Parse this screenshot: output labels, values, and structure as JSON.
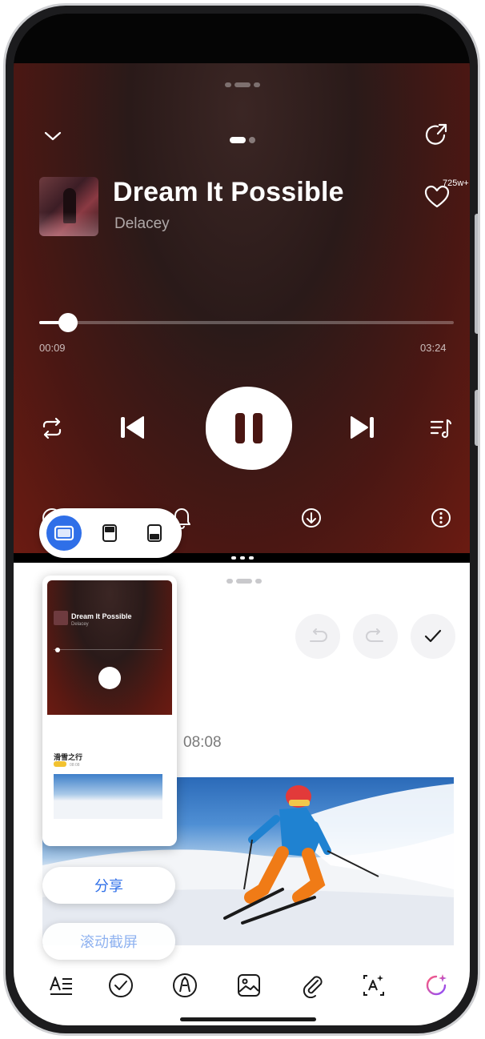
{
  "player": {
    "title": "Dream It Possible",
    "artist": "Delacey",
    "likes": "725w+",
    "time_elapsed": "00:09",
    "time_total": "03:24",
    "progress": 0.05,
    "accent": "#6b1b12"
  },
  "screenshot_modes": {
    "options": [
      "fullscreen",
      "top-window",
      "bottom-window"
    ],
    "selected": "fullscreen",
    "accent": "#2f6fe8"
  },
  "notes": {
    "time": "08:08"
  },
  "preview": {
    "title": "Dream It Possible",
    "artist": "Delacey",
    "note_heading": "滑雪之行",
    "note_date": "08:08"
  },
  "actions": {
    "share": "分享",
    "scroll_capture": "滚动截屏"
  },
  "toolbar_icons": [
    "text-format-icon",
    "checklist-icon",
    "pen-icon",
    "image-icon",
    "attachment-icon",
    "ai-text-icon",
    "ai-assist-icon"
  ]
}
